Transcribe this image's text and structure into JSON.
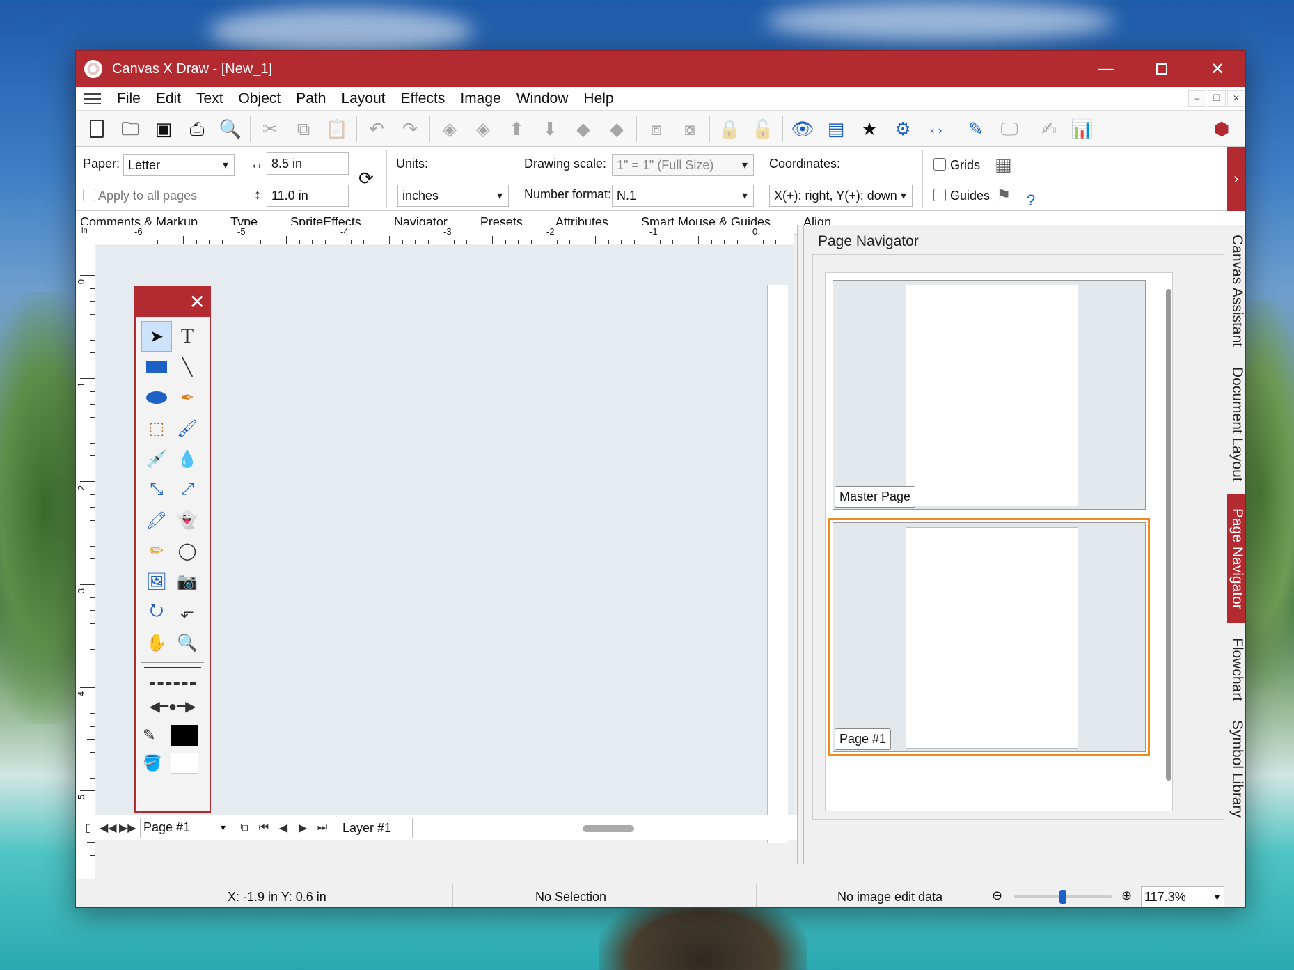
{
  "window": {
    "title": "Canvas X Draw - [New_1]"
  },
  "menu": [
    "File",
    "Edit",
    "Text",
    "Object",
    "Path",
    "Layout",
    "Effects",
    "Image",
    "Window",
    "Help"
  ],
  "toolbar": {
    "icons": [
      "new-doc-icon",
      "open-icon",
      "save-icon",
      "print-icon",
      "print-preview-icon",
      "cut-icon",
      "copy-icon",
      "paste-icon",
      "undo-icon",
      "redo-icon",
      "layer-icon",
      "layer-icon",
      "layer-icon",
      "layer-icon",
      "layer-icon",
      "layer-icon",
      "group-icon",
      "ungroup-icon",
      "lock-icon",
      "unlock-icon",
      "view-icon",
      "window-icon",
      "effects-icon",
      "settings-icon",
      "fit-icon",
      "edit-icon",
      "monitor-icon",
      "chart-edit-icon",
      "chart-icon"
    ]
  },
  "props": {
    "paper_label": "Paper:",
    "paper_value": "Letter",
    "width_value": "8.5 in",
    "height_value": "11.0 in",
    "apply_all": "Apply to all pages",
    "units_label": "Units:",
    "units_value": "inches",
    "scale_label": "Drawing scale:",
    "scale_value": "1\" = 1\"  (Full Size)",
    "numfmt_label": "Number format:",
    "numfmt_value": "N.1",
    "coords_label": "Coordinates:",
    "coords_value": "X(+): right, Y(+): down",
    "grids_label": "Grids",
    "guides_label": "Guides",
    "help_glyph": "?"
  },
  "tabs": [
    "Comments & Markup",
    "Type",
    "SpriteEffects",
    "Navigator",
    "Presets",
    "Attributes",
    "Smart Mouse & Guides",
    "Align"
  ],
  "ruler": {
    "unit": "in",
    "top": [
      "-6",
      "-5",
      "-4",
      "-3",
      "-2",
      "-1",
      "0"
    ],
    "left": [
      "0",
      "1",
      "2",
      "3",
      "4",
      "5"
    ]
  },
  "bottom_nav": {
    "page": "Page #1",
    "layer": "Layer #1"
  },
  "panel": {
    "title": "Page Navigator",
    "pages": [
      {
        "label": "Master Page"
      },
      {
        "label": "Page #1"
      }
    ]
  },
  "vtabs": [
    "Canvas Assistant",
    "Document Layout",
    "Page Navigator",
    "Flowchart",
    "Symbol Library"
  ],
  "status": {
    "coords": "X: -1.9 in Y: 0.6 in",
    "selection": "No Selection",
    "image": "No image edit data",
    "zoom": "117.3%",
    "zoom_level": 0.5
  },
  "colors": {
    "accent": "#b32a31",
    "selection": "#f08a1c",
    "tool_blue": "#1d61c7"
  }
}
